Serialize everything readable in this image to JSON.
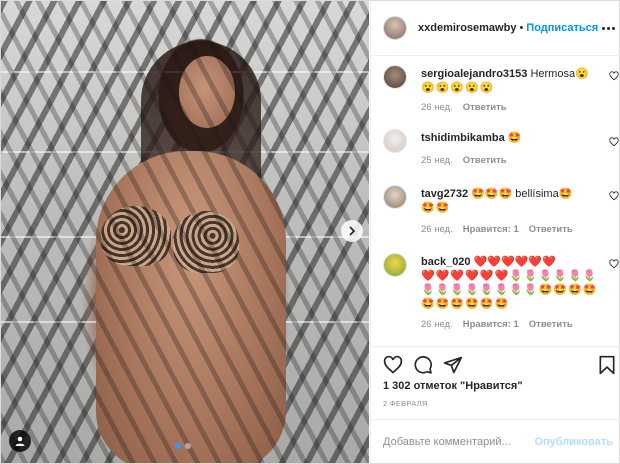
{
  "post": {
    "author": "xxdemirosemawby",
    "separator": "•",
    "follow_label": "Подписаться",
    "likes_text": "1 302 отметок \"Нравится\"",
    "date_text": "2 февраля",
    "comment_placeholder": "Добавьте комментарий...",
    "publish_label": "Опубликовать",
    "carousel": {
      "slides": 2,
      "active": 1
    }
  },
  "comments": [
    {
      "user": "sergioalejandro3153",
      "text": " Hermosa😮",
      "text2": "😮😮😮😮😮",
      "time": "26 нед.",
      "likes": "",
      "reply": "Ответить"
    },
    {
      "user": "tshidimbikamba",
      "text": " 🤩",
      "text2": "",
      "time": "25 нед.",
      "likes": "",
      "reply": "Ответить"
    },
    {
      "user": "tavg2732",
      "text": " 🤩🤩🤩 bellísima🤩",
      "text2": "🤩🤩",
      "time": "26 нед.",
      "likes": "Нравится: 1",
      "reply": "Ответить"
    },
    {
      "user": "back_020",
      "text": " ❤️❤️❤️❤️❤️❤️",
      "text2": "❤️❤️❤️❤️❤️❤️🌷🌷🌷🌷🌷🌷🌷🌷🌷🌷🌷🌷🌷🌷🤩🤩🤩🤩🤩🤩🤩🤩🤩🤩",
      "time": "26 нед.",
      "likes": "Нравится: 1",
      "reply": "Ответить"
    }
  ],
  "icons": {
    "heart": "heart-icon",
    "comment": "comment-icon",
    "share": "share-icon",
    "save": "bookmark-icon",
    "next": "chevron-right-icon",
    "tag": "user-tag-icon"
  },
  "colors": {
    "link": "#0095f6",
    "muted": "#8e8e8e",
    "text": "#262626",
    "dot_active": "#3897f0"
  }
}
